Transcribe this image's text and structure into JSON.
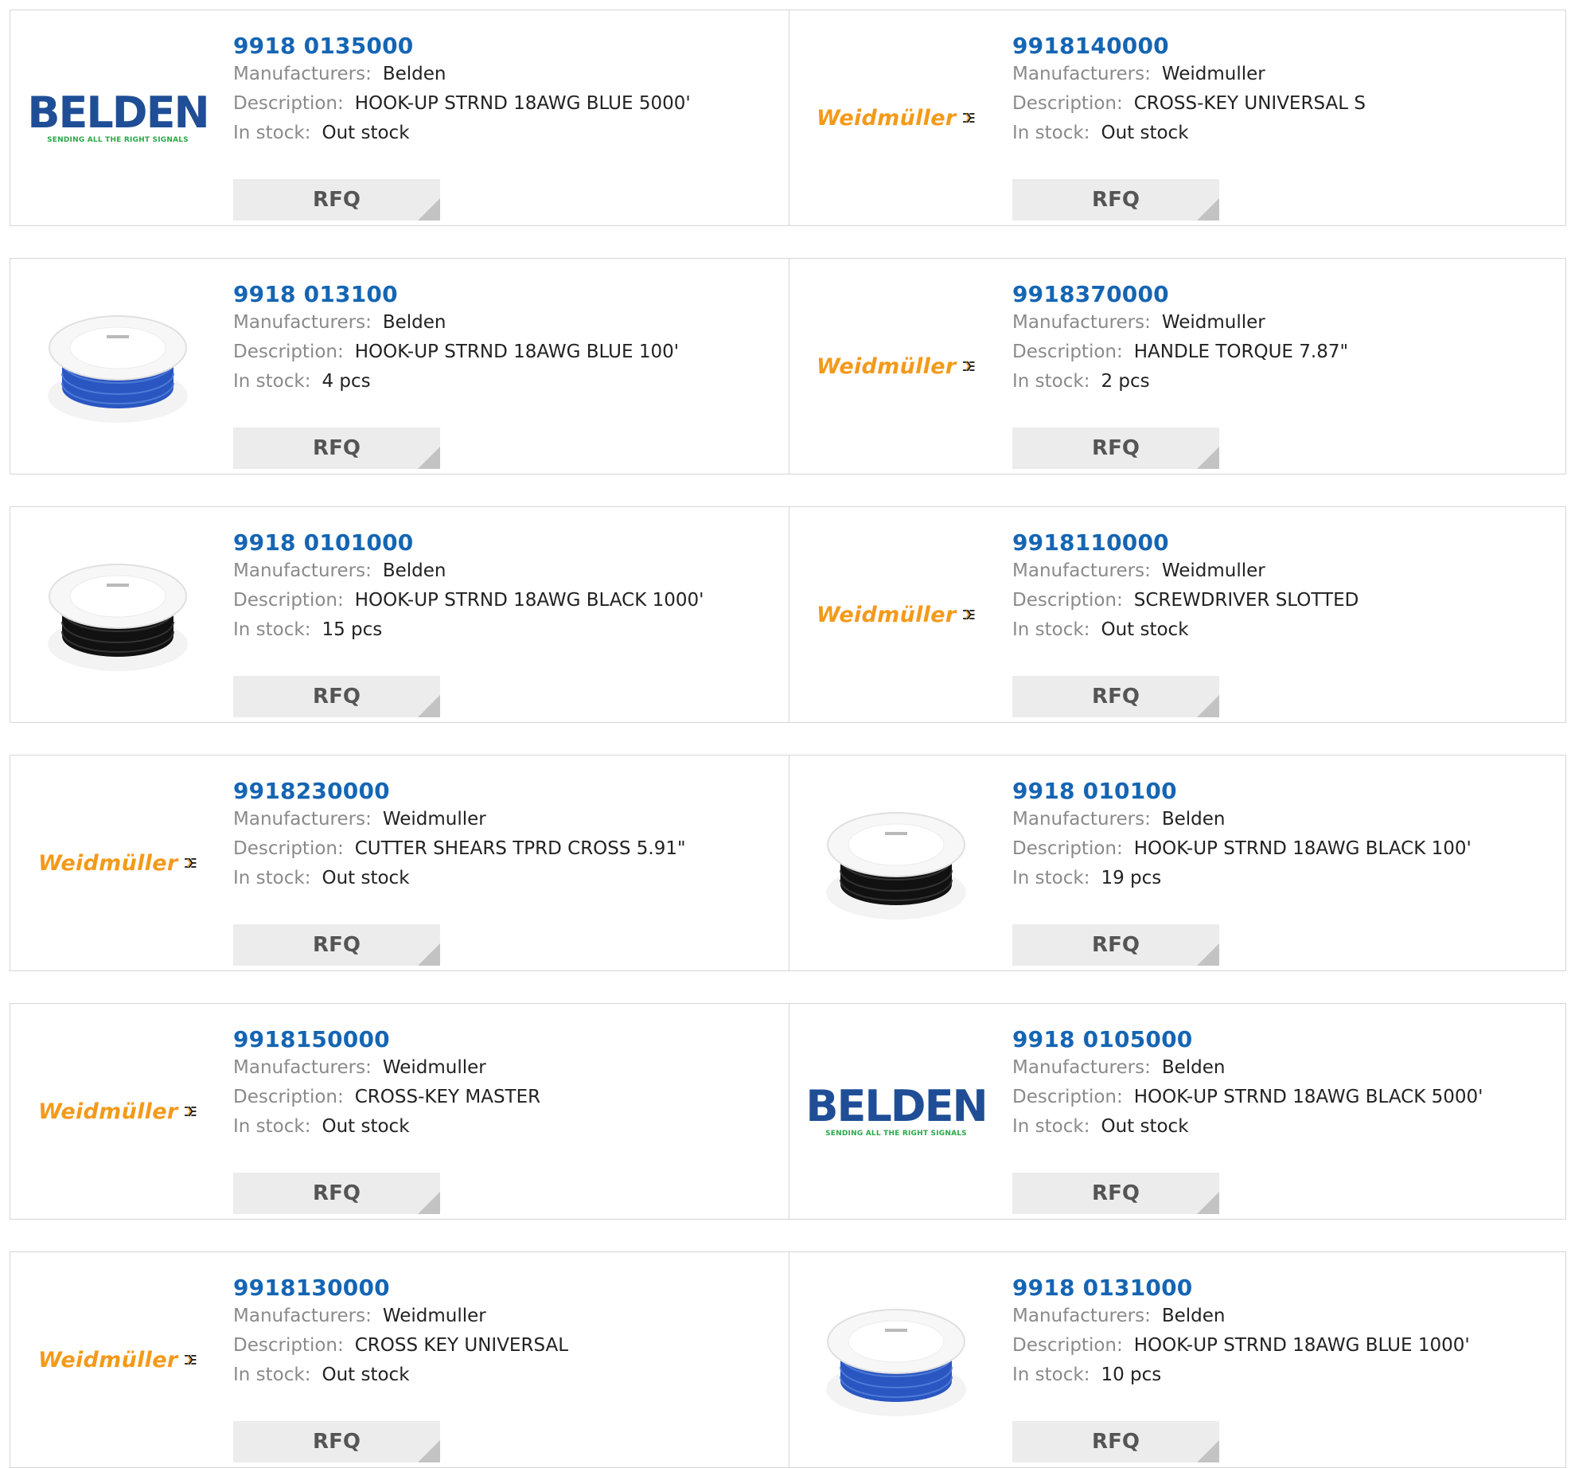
{
  "labels": {
    "manufacturer": "Manufacturers:",
    "description": "Description:",
    "stock": "In stock:",
    "rfq": "RFQ"
  },
  "logos": {
    "belden": {
      "wordmark": "BELDEN",
      "tagline": "SENDING ALL THE RIGHT SIGNALS",
      "color": "#1f4e96",
      "tagline_color": "#2aa84a"
    },
    "weidmuller": {
      "wordmark": "Weidmüller",
      "color": "#f39a1a"
    }
  },
  "colors": {
    "part_link": "#1565b3",
    "label": "#8a8a8a",
    "button_bg": "#ececec",
    "border": "#d6d6d6"
  },
  "products": [
    {
      "part": "9918 0135000",
      "manufacturer": "Belden",
      "description": "HOOK-UP STRND 18AWG BLUE 5000'",
      "stock": "Out stock",
      "image": "belden-logo"
    },
    {
      "part": "9918140000",
      "manufacturer": "Weidmuller",
      "description": "CROSS-KEY UNIVERSAL S",
      "stock": "Out stock",
      "image": "weidmuller-logo"
    },
    {
      "part": "9918 013100",
      "manufacturer": "Belden",
      "description": "HOOK-UP STRND 18AWG BLUE 100'",
      "stock": "4 pcs",
      "image": "blue-wire-spool"
    },
    {
      "part": "9918370000",
      "manufacturer": "Weidmuller",
      "description": "HANDLE TORQUE 7.87\"",
      "stock": "2 pcs",
      "image": "weidmuller-logo"
    },
    {
      "part": "9918 0101000",
      "manufacturer": "Belden",
      "description": "HOOK-UP STRND 18AWG BLACK 1000'",
      "stock": "15 pcs",
      "image": "black-wire-spool"
    },
    {
      "part": "9918110000",
      "manufacturer": "Weidmuller",
      "description": "SCREWDRIVER SLOTTED",
      "stock": "Out stock",
      "image": "weidmuller-logo"
    },
    {
      "part": "9918230000",
      "manufacturer": "Weidmuller",
      "description": "CUTTER SHEARS TPRD CROSS 5.91\"",
      "stock": "Out stock",
      "image": "weidmuller-logo"
    },
    {
      "part": "9918 010100",
      "manufacturer": "Belden",
      "description": "HOOK-UP STRND 18AWG BLACK 100'",
      "stock": "19 pcs",
      "image": "black-wire-spool"
    },
    {
      "part": "9918150000",
      "manufacturer": "Weidmuller",
      "description": "CROSS-KEY MASTER",
      "stock": "Out stock",
      "image": "weidmuller-logo"
    },
    {
      "part": "9918 0105000",
      "manufacturer": "Belden",
      "description": "HOOK-UP STRND 18AWG BLACK 5000'",
      "stock": "Out stock",
      "image": "belden-logo"
    },
    {
      "part": "9918130000",
      "manufacturer": "Weidmuller",
      "description": "CROSS KEY UNIVERSAL",
      "stock": "Out stock",
      "image": "weidmuller-logo"
    },
    {
      "part": "9918 0131000",
      "manufacturer": "Belden",
      "description": "HOOK-UP STRND 18AWG BLUE 1000'",
      "stock": "10 pcs",
      "image": "blue-wire-spool"
    }
  ]
}
